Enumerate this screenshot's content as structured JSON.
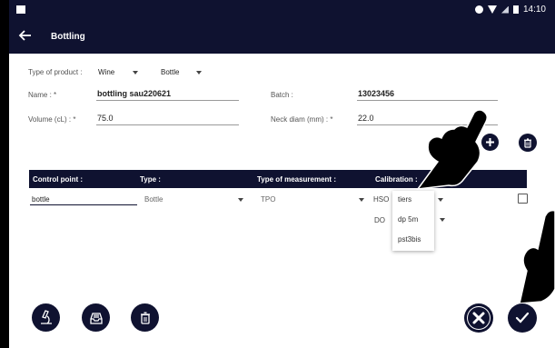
{
  "status_bar": {
    "time": "14:10"
  },
  "app_bar": {
    "title": "Bottling"
  },
  "form": {
    "type_of_product_label": "Type of product :",
    "product_value": "Wine",
    "container_value": "Bottle",
    "name_label": "Name : *",
    "name_value": "bottling sau220621",
    "batch_label": "Batch :",
    "batch_value": "13023456",
    "volume_label": "Volume (cL) : *",
    "volume_value": "75.0",
    "neck_label": "Neck diam (mm) : *",
    "neck_value": "22.0"
  },
  "table": {
    "headers": [
      "Control point :",
      "Type :",
      "Type of measurement :",
      "Calibration :"
    ],
    "row": {
      "control_point": "bottle",
      "type": "Bottle",
      "measurement": "TPO",
      "hso_label": "HSO",
      "do_label": "DO",
      "hso_value": "tiers"
    }
  },
  "calibration_dropdown": {
    "options": [
      "tiers",
      "dp 5m",
      "pst3bis"
    ]
  },
  "icons": {
    "add": "add-circle-icon",
    "delete_top": "trash-icon",
    "microscope": "microscope-icon",
    "inbox": "inbox-tray-icon",
    "delete_bottom": "trash-icon",
    "cancel": "close-icon",
    "confirm": "check-icon",
    "hand": "pointing-hand-icon"
  },
  "colors": {
    "primary": "#0f1230",
    "background": "#ffffff"
  }
}
